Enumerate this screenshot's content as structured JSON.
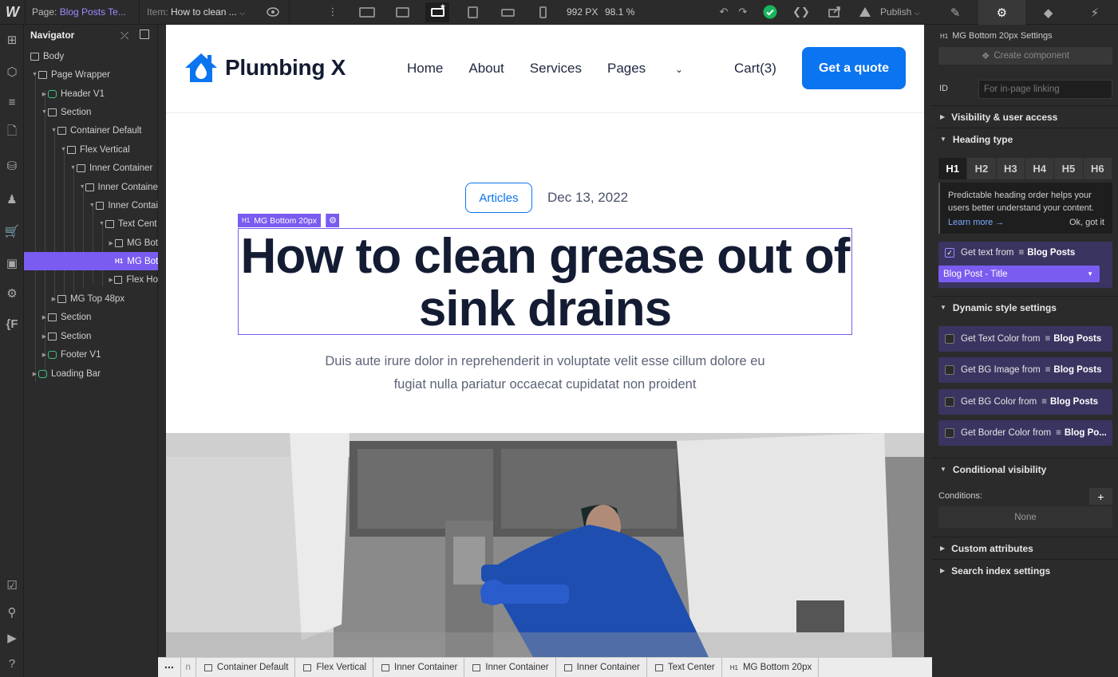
{
  "topbar": {
    "logo": "W",
    "page_label": "Page:",
    "page_value": "Blog Posts Te...",
    "item_label": "Item:",
    "item_value": "How to clean ...",
    "width_value": "992 PX",
    "zoom_value": "98.1 %",
    "publish_label": "Publish"
  },
  "navigator": {
    "title": "Navigator",
    "items": [
      {
        "label": "Body"
      },
      {
        "label": "Page Wrapper"
      },
      {
        "label": "Header V1"
      },
      {
        "label": "Section"
      },
      {
        "label": "Container Default"
      },
      {
        "label": "Flex Vertical"
      },
      {
        "label": "Inner Container"
      },
      {
        "label": "Inner Containe"
      },
      {
        "label": "Inner Contai"
      },
      {
        "label": "Text Cent"
      },
      {
        "label": "MG Bot"
      },
      {
        "label": "MG Bot"
      },
      {
        "label": "Flex Ho"
      },
      {
        "label": "MG Top 48px"
      },
      {
        "label": "Section"
      },
      {
        "label": "Section"
      },
      {
        "label": "Footer V1"
      },
      {
        "label": "Loading Bar"
      }
    ]
  },
  "site": {
    "brand": "Plumbing X",
    "menu": [
      "Home",
      "About",
      "Services",
      "Pages",
      "Cart(3)"
    ],
    "cta": "Get a quote",
    "tag": "Articles",
    "date": "Dec 13, 2022",
    "selection_label": "MG Bottom 20px",
    "headline": "How to clean grease out of sink drains",
    "lede": "Duis aute irure dolor in reprehenderit in voluptate velit esse cillum dolore eu fugiat nulla pariatur occaecat cupidatat non proident"
  },
  "settings": {
    "element_title": "MG Bottom 20px Settings",
    "create_component": "Create component",
    "id_label": "ID",
    "id_placeholder": "For in-page linking",
    "visibility_label": "Visibility & user access",
    "heading_type_label": "Heading type",
    "heading_levels": [
      "H1",
      "H2",
      "H3",
      "H4",
      "H5",
      "H6"
    ],
    "notice_text": "Predictable heading order helps your users better understand your content.",
    "learn_more": "Learn more →",
    "ok_got_it": "Ok, got it",
    "get_text_from": "Get text from",
    "collection": "Blog Posts",
    "bound_field": "Blog Post - Title",
    "dynamic_style_label": "Dynamic style settings",
    "dynamic_rows": [
      {
        "label": "Get Text Color from",
        "collection": "Blog Posts"
      },
      {
        "label": "Get BG Image from",
        "collection": "Blog Posts"
      },
      {
        "label": "Get BG Color from",
        "collection": "Blog Posts"
      },
      {
        "label": "Get Border Color from",
        "collection": "Blog Po..."
      }
    ],
    "conditional_label": "Conditional visibility",
    "conditions_label": "Conditions:",
    "conditions_value": "None",
    "custom_attributes_label": "Custom attributes",
    "search_index_label": "Search index settings"
  },
  "breadcrumbs": [
    "Container Default",
    "Flex Vertical",
    "Inner Container",
    "Inner Container",
    "Inner Container",
    "Text Center",
    "MG Bottom 20px"
  ]
}
